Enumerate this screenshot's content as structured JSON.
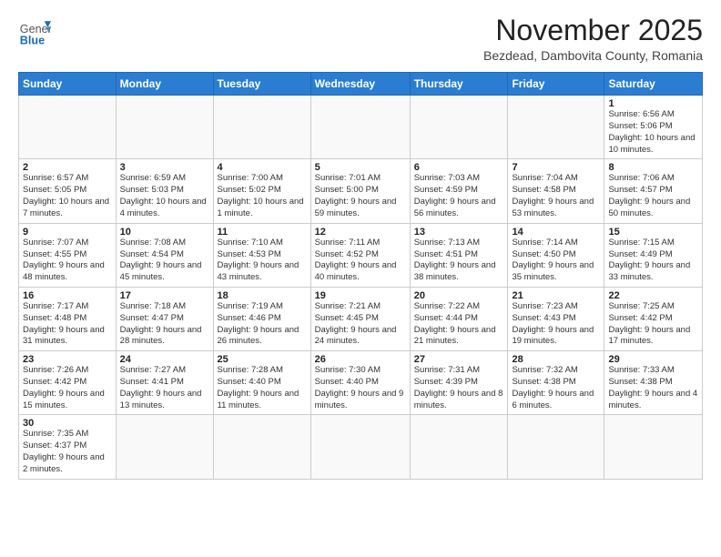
{
  "header": {
    "logo_general": "General",
    "logo_blue": "Blue",
    "month_year": "November 2025",
    "location": "Bezdead, Dambovita County, Romania"
  },
  "days_of_week": [
    "Sunday",
    "Monday",
    "Tuesday",
    "Wednesday",
    "Thursday",
    "Friday",
    "Saturday"
  ],
  "weeks": [
    [
      {
        "day": "",
        "info": ""
      },
      {
        "day": "",
        "info": ""
      },
      {
        "day": "",
        "info": ""
      },
      {
        "day": "",
        "info": ""
      },
      {
        "day": "",
        "info": ""
      },
      {
        "day": "",
        "info": ""
      },
      {
        "day": "1",
        "info": "Sunrise: 6:56 AM\nSunset: 5:06 PM\nDaylight: 10 hours\nand 10 minutes."
      }
    ],
    [
      {
        "day": "2",
        "info": "Sunrise: 6:57 AM\nSunset: 5:05 PM\nDaylight: 10 hours\nand 7 minutes."
      },
      {
        "day": "3",
        "info": "Sunrise: 6:59 AM\nSunset: 5:03 PM\nDaylight: 10 hours\nand 4 minutes."
      },
      {
        "day": "4",
        "info": "Sunrise: 7:00 AM\nSunset: 5:02 PM\nDaylight: 10 hours\nand 1 minute."
      },
      {
        "day": "5",
        "info": "Sunrise: 7:01 AM\nSunset: 5:00 PM\nDaylight: 9 hours\nand 59 minutes."
      },
      {
        "day": "6",
        "info": "Sunrise: 7:03 AM\nSunset: 4:59 PM\nDaylight: 9 hours\nand 56 minutes."
      },
      {
        "day": "7",
        "info": "Sunrise: 7:04 AM\nSunset: 4:58 PM\nDaylight: 9 hours\nand 53 minutes."
      },
      {
        "day": "8",
        "info": "Sunrise: 7:06 AM\nSunset: 4:57 PM\nDaylight: 9 hours\nand 50 minutes."
      }
    ],
    [
      {
        "day": "9",
        "info": "Sunrise: 7:07 AM\nSunset: 4:55 PM\nDaylight: 9 hours\nand 48 minutes."
      },
      {
        "day": "10",
        "info": "Sunrise: 7:08 AM\nSunset: 4:54 PM\nDaylight: 9 hours\nand 45 minutes."
      },
      {
        "day": "11",
        "info": "Sunrise: 7:10 AM\nSunset: 4:53 PM\nDaylight: 9 hours\nand 43 minutes."
      },
      {
        "day": "12",
        "info": "Sunrise: 7:11 AM\nSunset: 4:52 PM\nDaylight: 9 hours\nand 40 minutes."
      },
      {
        "day": "13",
        "info": "Sunrise: 7:13 AM\nSunset: 4:51 PM\nDaylight: 9 hours\nand 38 minutes."
      },
      {
        "day": "14",
        "info": "Sunrise: 7:14 AM\nSunset: 4:50 PM\nDaylight: 9 hours\nand 35 minutes."
      },
      {
        "day": "15",
        "info": "Sunrise: 7:15 AM\nSunset: 4:49 PM\nDaylight: 9 hours\nand 33 minutes."
      }
    ],
    [
      {
        "day": "16",
        "info": "Sunrise: 7:17 AM\nSunset: 4:48 PM\nDaylight: 9 hours\nand 31 minutes."
      },
      {
        "day": "17",
        "info": "Sunrise: 7:18 AM\nSunset: 4:47 PM\nDaylight: 9 hours\nand 28 minutes."
      },
      {
        "day": "18",
        "info": "Sunrise: 7:19 AM\nSunset: 4:46 PM\nDaylight: 9 hours\nand 26 minutes."
      },
      {
        "day": "19",
        "info": "Sunrise: 7:21 AM\nSunset: 4:45 PM\nDaylight: 9 hours\nand 24 minutes."
      },
      {
        "day": "20",
        "info": "Sunrise: 7:22 AM\nSunset: 4:44 PM\nDaylight: 9 hours\nand 21 minutes."
      },
      {
        "day": "21",
        "info": "Sunrise: 7:23 AM\nSunset: 4:43 PM\nDaylight: 9 hours\nand 19 minutes."
      },
      {
        "day": "22",
        "info": "Sunrise: 7:25 AM\nSunset: 4:42 PM\nDaylight: 9 hours\nand 17 minutes."
      }
    ],
    [
      {
        "day": "23",
        "info": "Sunrise: 7:26 AM\nSunset: 4:42 PM\nDaylight: 9 hours\nand 15 minutes."
      },
      {
        "day": "24",
        "info": "Sunrise: 7:27 AM\nSunset: 4:41 PM\nDaylight: 9 hours\nand 13 minutes."
      },
      {
        "day": "25",
        "info": "Sunrise: 7:28 AM\nSunset: 4:40 PM\nDaylight: 9 hours\nand 11 minutes."
      },
      {
        "day": "26",
        "info": "Sunrise: 7:30 AM\nSunset: 4:40 PM\nDaylight: 9 hours\nand 9 minutes."
      },
      {
        "day": "27",
        "info": "Sunrise: 7:31 AM\nSunset: 4:39 PM\nDaylight: 9 hours\nand 8 minutes."
      },
      {
        "day": "28",
        "info": "Sunrise: 7:32 AM\nSunset: 4:38 PM\nDaylight: 9 hours\nand 6 minutes."
      },
      {
        "day": "29",
        "info": "Sunrise: 7:33 AM\nSunset: 4:38 PM\nDaylight: 9 hours\nand 4 minutes."
      }
    ],
    [
      {
        "day": "30",
        "info": "Sunrise: 7:35 AM\nSunset: 4:37 PM\nDaylight: 9 hours\nand 2 minutes."
      },
      {
        "day": "",
        "info": ""
      },
      {
        "day": "",
        "info": ""
      },
      {
        "day": "",
        "info": ""
      },
      {
        "day": "",
        "info": ""
      },
      {
        "day": "",
        "info": ""
      },
      {
        "day": "",
        "info": ""
      }
    ]
  ]
}
